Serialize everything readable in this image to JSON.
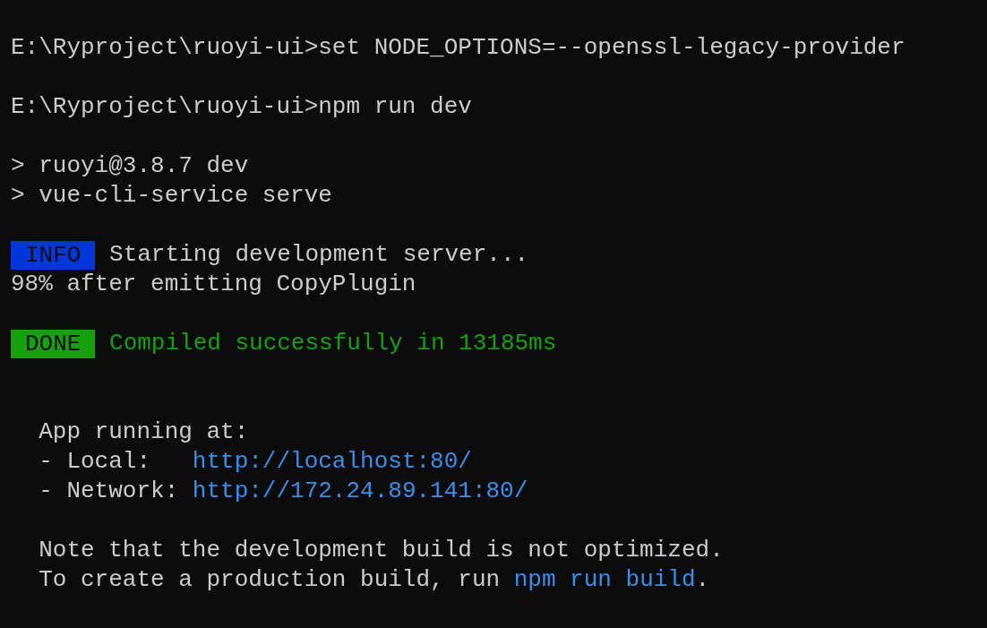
{
  "terminal": {
    "lines": [
      {
        "kind": "text",
        "segments": [
          {
            "kind": "plain",
            "text": "E:\\Ryproject\\ruoyi-ui>set NODE_OPTIONS=--openssl-legacy-provider"
          }
        ]
      },
      {
        "kind": "blank"
      },
      {
        "kind": "text",
        "segments": [
          {
            "kind": "plain",
            "text": "E:\\Ryproject\\ruoyi-ui>npm run dev"
          }
        ]
      },
      {
        "kind": "blank"
      },
      {
        "kind": "text",
        "segments": [
          {
            "kind": "plain",
            "text": "> ruoyi@3.8.7 dev"
          }
        ]
      },
      {
        "kind": "text",
        "segments": [
          {
            "kind": "plain",
            "text": "> vue-cli-service serve"
          }
        ]
      },
      {
        "kind": "blank"
      },
      {
        "kind": "text",
        "segments": [
          {
            "kind": "badge",
            "color": "#0037da",
            "text": "INFO"
          },
          {
            "kind": "plain",
            "text": " Starting development server..."
          }
        ]
      },
      {
        "kind": "text",
        "segments": [
          {
            "kind": "plain",
            "text": "98% after emitting CopyPlugin"
          }
        ]
      },
      {
        "kind": "blank"
      },
      {
        "kind": "text",
        "segments": [
          {
            "kind": "badge",
            "color": "#13a10e",
            "text": "DONE"
          },
          {
            "kind": "success",
            "text": " Compiled successfully in 13185ms"
          }
        ]
      },
      {
        "kind": "blank"
      },
      {
        "kind": "blank"
      },
      {
        "kind": "text",
        "segments": [
          {
            "kind": "plain",
            "text": "  App running at:"
          }
        ]
      },
      {
        "kind": "text",
        "segments": [
          {
            "kind": "plain",
            "text": "  - Local:   "
          },
          {
            "kind": "link",
            "text": "http://localhost:80/"
          }
        ]
      },
      {
        "kind": "text",
        "segments": [
          {
            "kind": "plain",
            "text": "  - Network: "
          },
          {
            "kind": "link",
            "text": "http://172.24.89.141:80/"
          }
        ]
      },
      {
        "kind": "blank"
      },
      {
        "kind": "text",
        "segments": [
          {
            "kind": "plain",
            "text": "  Note that the development build is not optimized."
          }
        ]
      },
      {
        "kind": "text",
        "segments": [
          {
            "kind": "plain",
            "text": "  To create a production build, run "
          },
          {
            "kind": "link",
            "text": "npm run build"
          },
          {
            "kind": "plain",
            "text": "."
          }
        ]
      }
    ]
  }
}
